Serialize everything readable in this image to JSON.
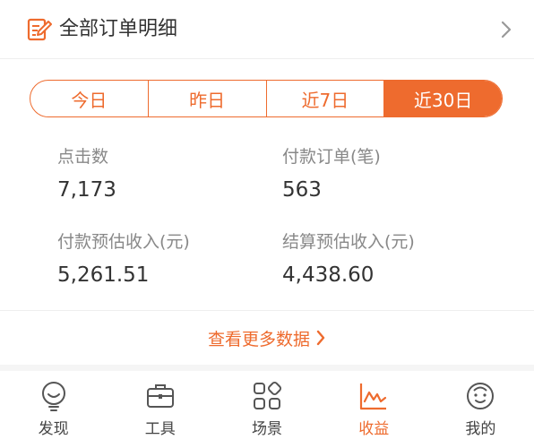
{
  "header": {
    "title": "全部订单明细",
    "icon": "edit-document-icon"
  },
  "tabs": [
    {
      "label": "今日",
      "active": false
    },
    {
      "label": "昨日",
      "active": false
    },
    {
      "label": "近7日",
      "active": false
    },
    {
      "label": "近30日",
      "active": true
    }
  ],
  "stats": {
    "clicks": {
      "label": "点击数",
      "value": "7,173"
    },
    "paid_orders": {
      "label": "付款订单(笔)",
      "value": "563"
    },
    "est_paid_income": {
      "label": "付款预估收入(元)",
      "value": "5,261.51"
    },
    "est_settled_income": {
      "label": "结算预估收入(元)",
      "value": "4,438.60"
    }
  },
  "more_link": {
    "label": "查看更多数据"
  },
  "nav": [
    {
      "label": "发现",
      "icon": "bulb-icon",
      "active": false
    },
    {
      "label": "工具",
      "icon": "toolbox-icon",
      "active": false
    },
    {
      "label": "场景",
      "icon": "grid-icon",
      "active": false
    },
    {
      "label": "收益",
      "icon": "chart-icon",
      "active": true
    },
    {
      "label": "我的",
      "icon": "smiley-face-icon",
      "active": false
    }
  ],
  "colors": {
    "accent": "#ee6b2e",
    "text": "#333333",
    "muted": "#888888"
  }
}
